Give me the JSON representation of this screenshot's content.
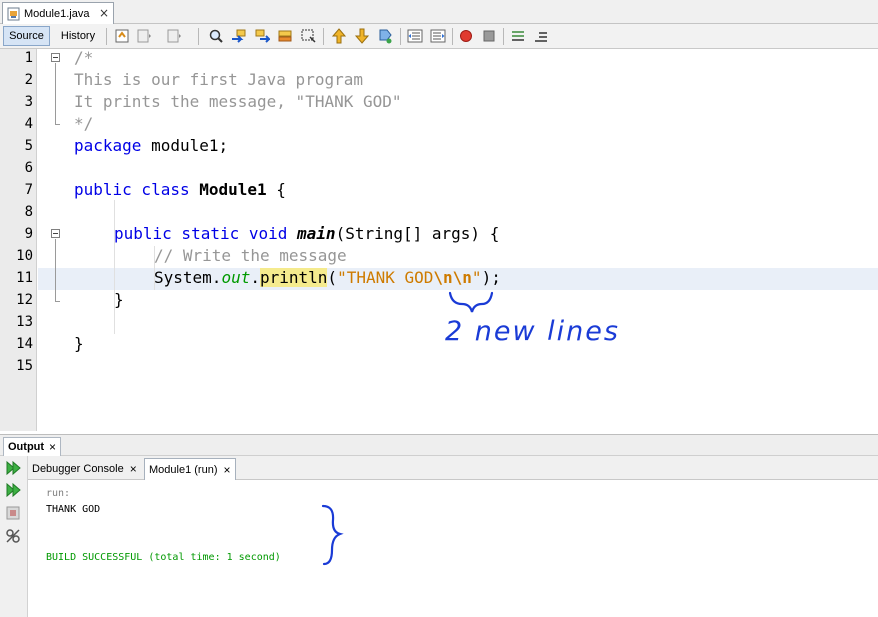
{
  "file_tab": {
    "label": "Module1.java",
    "close": "×"
  },
  "editor_toolbar": {
    "source_label": "Source",
    "history_label": "History"
  },
  "editor": {
    "line_numbers": [
      "1",
      "2",
      "3",
      "4",
      "5",
      "6",
      "7",
      "8",
      "9",
      "10",
      "11",
      "12",
      "13",
      "14",
      "15"
    ],
    "lines": {
      "l1": "/*",
      "l2": "This is our first Java program",
      "l3": "It prints the message, \"THANK GOD\"",
      "l4": "*/",
      "l5_kw": "package",
      "l5_rest": " module1;",
      "l7_kw": "public class",
      "l7_name": "Module1",
      "l7_rest": " {",
      "l9_kw": "public static void",
      "l9_method": "main",
      "l9_rest": "(String[] args) {",
      "l10": "// Write the message",
      "l11_obj": "System.",
      "l11_field": "out",
      "l11_dot": ".",
      "l11_method": "println",
      "l11_paren": "(",
      "l11_str": "\"THANK GOD",
      "l11_esc": "\\n\\n",
      "l11_strend": "\"",
      "l11_end": ");",
      "l12": "}",
      "l14": "}"
    },
    "annotation": "2 new lines"
  },
  "output": {
    "title": "Output",
    "close": "×",
    "tabs": [
      {
        "label": "Debugger Console",
        "close": "×"
      },
      {
        "label": "Module1 (run)",
        "close": "×"
      }
    ],
    "console": {
      "run": "run:",
      "printed": "THANK GOD",
      "result": "BUILD SUCCESSFUL (total time: 1 second)"
    }
  },
  "colors": {
    "keyword": "#0000e6",
    "comment": "#969696",
    "string": "#ce7b00",
    "field": "#009900",
    "success": "#009900",
    "annotation_ink": "#1a3bd6"
  }
}
